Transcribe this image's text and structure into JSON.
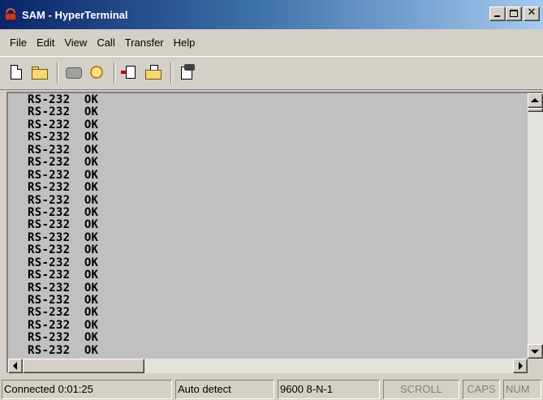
{
  "window": {
    "title": "SAM - HyperTerminal",
    "title_color_start": "#0a246a",
    "title_color_end": "#a6caf0"
  },
  "caption_buttons": {
    "minimize": "_",
    "maximize": "□",
    "close": "✕"
  },
  "menu": [
    "File",
    "Edit",
    "View",
    "Call",
    "Transfer",
    "Help"
  ],
  "toolbar": {
    "buttons": [
      "new-icon",
      "open-icon",
      "disconnect-icon",
      "connect-icon",
      "send-icon",
      "receive-icon",
      "properties-icon"
    ]
  },
  "terminal": {
    "background": "#c0c0c0",
    "lines": [
      "RS-232  OK",
      "RS-232  OK",
      "RS-232  OK",
      "RS-232  OK",
      "RS-232  OK",
      "RS-232  OK",
      "RS-232  OK",
      "RS-232  OK",
      "RS-232  OK",
      "RS-232  OK",
      "RS-232  OK",
      "RS-232  OK",
      "RS-232  OK",
      "RS-232  OK",
      "RS-232  OK",
      "RS-232  OK",
      "RS-232  OK",
      "RS-232  OK",
      "RS-232  OK",
      "RS-232  OK",
      "RS-232  OK"
    ]
  },
  "status": {
    "connection": "Connected 0:01:25",
    "detect": "Auto detect",
    "settings": "9600 8-N-1",
    "scroll": "SCROLL",
    "caps": "CAPS",
    "num": "NUM"
  }
}
